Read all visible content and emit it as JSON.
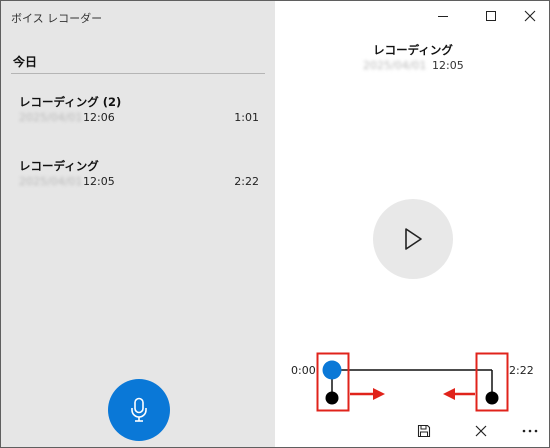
{
  "app": {
    "title": "ボイス レコーダー"
  },
  "list": {
    "section_title": "今日",
    "recordings": [
      {
        "name": "レコーディング (2)",
        "date": "2025/04/01",
        "time": "12:06",
        "duration": "1:01"
      },
      {
        "name": "レコーディング",
        "date": "2025/04/01",
        "time": "12:05",
        "duration": "2:22"
      }
    ]
  },
  "player": {
    "title": "レコーディング",
    "date": "2025/04/01",
    "time": "12:05",
    "start_time": "0:00",
    "end_time": "2:22"
  },
  "icons": {
    "minimize": "minimize-icon",
    "maximize": "maximize-icon",
    "close": "close-icon",
    "record": "microphone-icon",
    "play": "play-icon",
    "save": "save-icon",
    "delete": "close-icon",
    "more": "more-icon"
  },
  "colors": {
    "accent": "#0a78d7",
    "left_pane_bg": "#e6e6e6",
    "annotation_red": "#e0231b",
    "blurred_text": "#b9b9b9"
  }
}
